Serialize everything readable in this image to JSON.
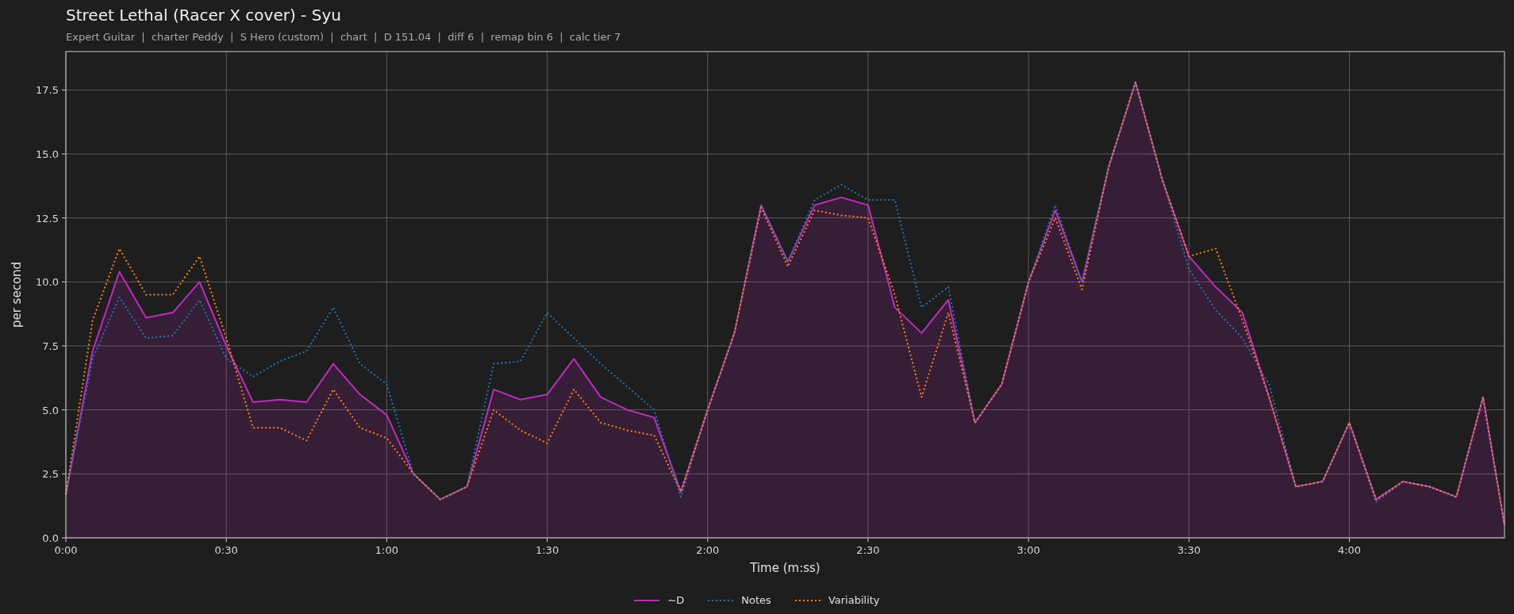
{
  "title": "Street Lethal (Racer X cover) - Syu",
  "subtitle": "Expert Guitar  |  charter Peddy  |  S Hero (custom)  |  chart  |  D 151.04  |  diff 6  |  remap bin 6  |  calc tier 7",
  "chart_data": {
    "type": "line",
    "xlabel": "Time (m:ss)",
    "ylabel": "per second",
    "x": [
      0,
      5,
      10,
      15,
      20,
      25,
      30,
      35,
      40,
      45,
      50,
      55,
      60,
      65,
      70,
      75,
      80,
      85,
      90,
      95,
      100,
      105,
      110,
      115,
      120,
      125,
      130,
      135,
      140,
      145,
      150,
      155,
      160,
      165,
      170,
      175,
      180,
      185,
      190,
      195,
      200,
      205,
      210,
      215,
      220,
      225,
      230,
      235,
      240,
      245,
      250,
      255,
      260,
      265,
      269
    ],
    "series": [
      {
        "name": "~D",
        "color": "#c02ac0",
        "type": "area",
        "line_style": "solid",
        "values": [
          1.7,
          7.3,
          10.4,
          8.6,
          8.8,
          10.0,
          7.5,
          5.3,
          5.4,
          5.3,
          6.8,
          5.6,
          4.8,
          2.5,
          1.5,
          2.0,
          5.8,
          5.4,
          5.6,
          7.0,
          5.5,
          5.0,
          4.7,
          1.8,
          5.0,
          8.0,
          13.0,
          10.8,
          13.0,
          13.3,
          13.0,
          9.0,
          8.0,
          9.3,
          4.5,
          6.0,
          10.0,
          12.8,
          10.0,
          14.5,
          17.8,
          14.0,
          11.0,
          9.8,
          8.8,
          5.5,
          2.0,
          2.2,
          4.5,
          1.5,
          2.2,
          2.0,
          1.6,
          5.5,
          0.5
        ]
      },
      {
        "name": "Notes",
        "color": "#1f77b4",
        "type": "line",
        "line_style": "dotted",
        "values": [
          1.7,
          7.0,
          9.4,
          7.8,
          7.9,
          9.3,
          7.0,
          6.3,
          6.9,
          7.3,
          9.0,
          6.8,
          6.0,
          2.5,
          1.5,
          2.0,
          6.8,
          6.9,
          8.8,
          7.8,
          6.8,
          5.9,
          5.0,
          1.6,
          5.0,
          8.0,
          13.0,
          10.8,
          13.2,
          13.8,
          13.2,
          13.2,
          9.0,
          9.8,
          4.5,
          6.0,
          10.0,
          13.0,
          10.0,
          14.5,
          17.8,
          14.0,
          10.5,
          8.9,
          7.8,
          6.0,
          2.0,
          2.2,
          4.5,
          1.4,
          2.2,
          2.0,
          1.6,
          5.5,
          0.5
        ]
      },
      {
        "name": "Variability",
        "color": "#ff7f0e",
        "type": "line",
        "line_style": "dotted",
        "values": [
          1.7,
          8.5,
          11.3,
          9.5,
          9.5,
          11.0,
          7.8,
          4.3,
          4.3,
          3.8,
          5.8,
          4.3,
          3.9,
          2.5,
          1.5,
          2.0,
          5.0,
          4.2,
          3.7,
          5.8,
          4.5,
          4.2,
          4.0,
          1.8,
          5.0,
          8.0,
          12.9,
          10.6,
          12.8,
          12.6,
          12.5,
          9.5,
          5.5,
          8.8,
          4.5,
          6.0,
          10.0,
          12.5,
          9.7,
          14.5,
          17.8,
          14.0,
          11.0,
          11.3,
          8.5,
          5.5,
          2.0,
          2.2,
          4.5,
          1.5,
          2.2,
          2.0,
          1.6,
          5.5,
          0.5
        ]
      }
    ],
    "xlim": [
      0,
      269
    ],
    "ylim": [
      0,
      19
    ],
    "grid": true,
    "xticks": [
      {
        "value": 0,
        "label": "0:00"
      },
      {
        "value": 30,
        "label": "0:30"
      },
      {
        "value": 60,
        "label": "1:00"
      },
      {
        "value": 90,
        "label": "1:30"
      },
      {
        "value": 120,
        "label": "2:00"
      },
      {
        "value": 150,
        "label": "2:30"
      },
      {
        "value": 180,
        "label": "3:00"
      },
      {
        "value": 210,
        "label": "3:30"
      },
      {
        "value": 240,
        "label": "4:00"
      }
    ],
    "yticks": [
      {
        "value": 0,
        "label": "0.0"
      },
      {
        "value": 2.5,
        "label": "2.5"
      },
      {
        "value": 5,
        "label": "5.0"
      },
      {
        "value": 7.5,
        "label": "7.5"
      },
      {
        "value": 10,
        "label": "10.0"
      },
      {
        "value": 12.5,
        "label": "12.5"
      },
      {
        "value": 15,
        "label": "15.0"
      },
      {
        "value": 17.5,
        "label": "17.5"
      }
    ]
  }
}
